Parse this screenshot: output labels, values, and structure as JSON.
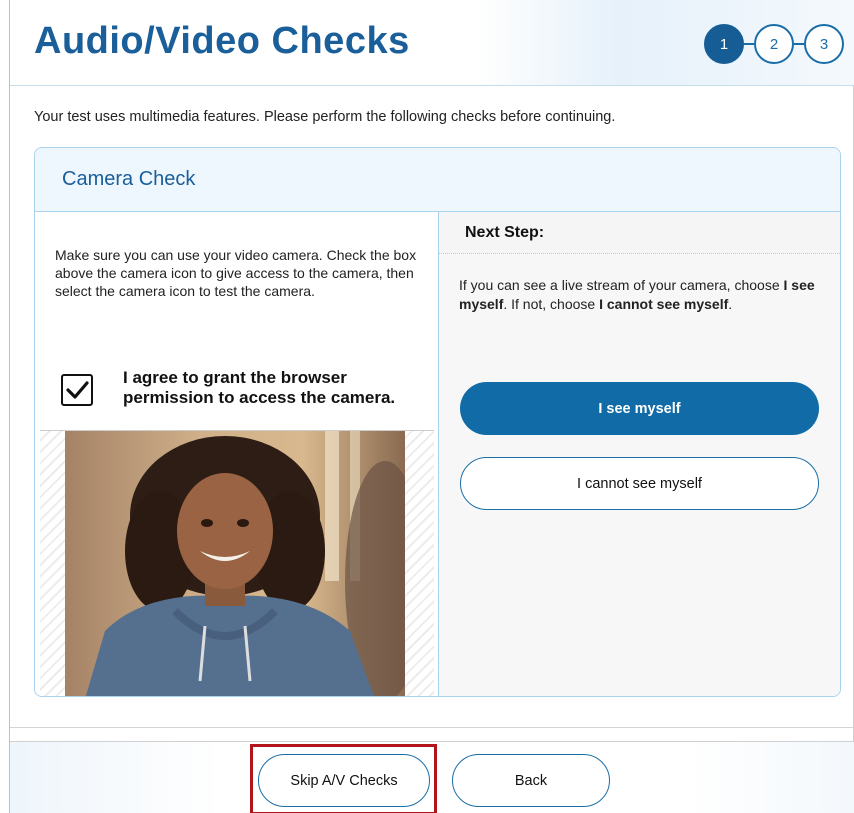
{
  "header": {
    "title": "Audio/Video Checks",
    "steps": [
      "1",
      "2",
      "3"
    ],
    "active_step": "1"
  },
  "intro": "Your test uses multimedia features. Please perform the following checks before continuing.",
  "camera_card": {
    "title": "Camera Check",
    "description": "Make sure you can use your video camera. Check the box above the camera icon to give access to the camera, then select the camera icon to test the camera.",
    "agree_label": "I agree to grant the browser permission to access the camera.",
    "agree_checked": true,
    "next_step": {
      "heading": "Next Step:",
      "text_1": "If you can see a live stream of your camera, choose ",
      "bold_1": "I see myself",
      "text_2": ". If not, choose ",
      "bold_2": "I cannot see myself",
      "text_3": ".",
      "see_button": "I see myself",
      "cannot_see_button": "I cannot see myself"
    }
  },
  "footer": {
    "skip_label": "Skip A/V Checks",
    "back_label": "Back"
  },
  "colors": {
    "primary": "#106ba6",
    "title": "#1a5e9a",
    "border": "#a9d2ec",
    "highlight": "#b3131b"
  }
}
